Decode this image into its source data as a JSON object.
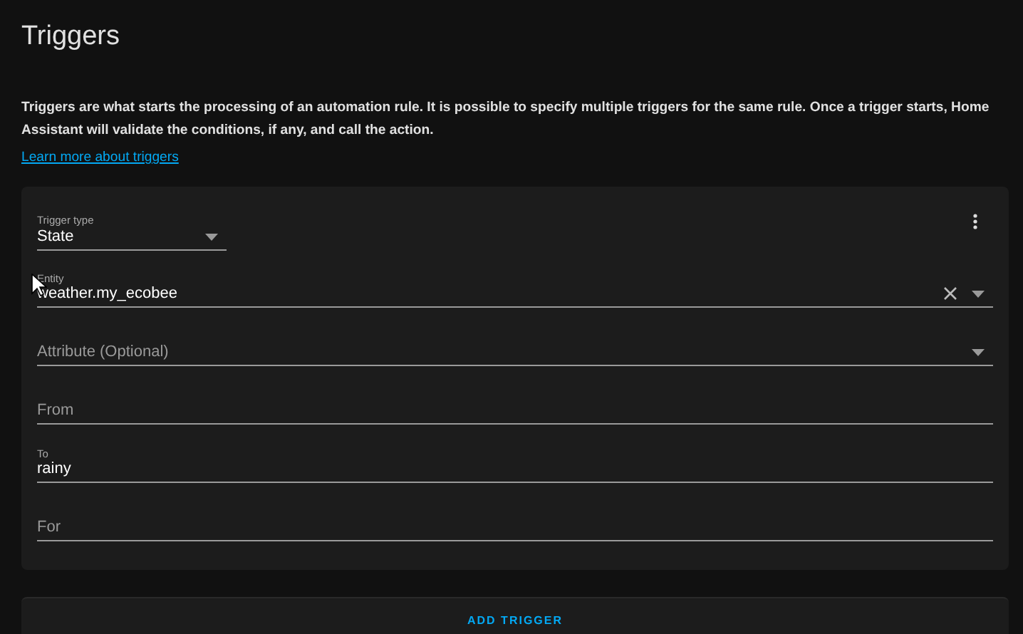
{
  "title": "Triggers",
  "description": "Triggers are what starts the processing of an automation rule. It is possible to specify multiple triggers for the same rule. Once a trigger starts, Home Assistant will validate the conditions, if any, and call the action.",
  "learn_more_link": "Learn more about triggers",
  "trigger_card": {
    "type_field": {
      "label": "Trigger type",
      "value": "State"
    },
    "fields": [
      {
        "kind": "entity",
        "label": "Entity",
        "value": "weather.my_ecobee"
      },
      {
        "kind": "select",
        "label": "Attribute (Optional)"
      },
      {
        "kind": "text",
        "label": "From"
      },
      {
        "kind": "text",
        "label": "To",
        "value": "rainy"
      },
      {
        "kind": "text",
        "label": "For"
      }
    ]
  },
  "add_button": "ADD TRIGGER"
}
